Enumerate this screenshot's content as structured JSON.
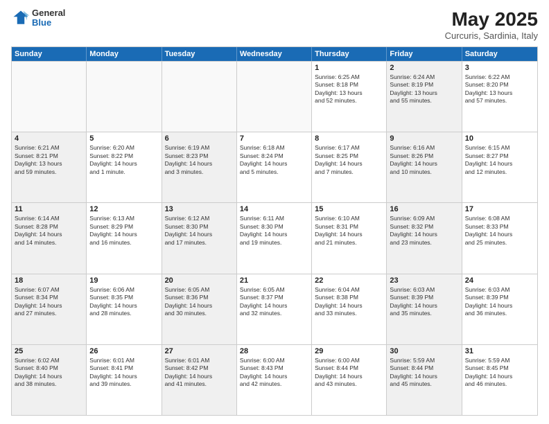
{
  "header": {
    "logo": {
      "general": "General",
      "blue": "Blue"
    },
    "title": "May 2025",
    "location": "Curcuris, Sardinia, Italy"
  },
  "days_of_week": [
    "Sunday",
    "Monday",
    "Tuesday",
    "Wednesday",
    "Thursday",
    "Friday",
    "Saturday"
  ],
  "rows": [
    [
      {
        "day": "",
        "detail": "",
        "empty": true
      },
      {
        "day": "",
        "detail": "",
        "empty": true
      },
      {
        "day": "",
        "detail": "",
        "empty": true
      },
      {
        "day": "",
        "detail": "",
        "empty": true
      },
      {
        "day": "1",
        "detail": "Sunrise: 6:25 AM\nSunset: 8:18 PM\nDaylight: 13 hours\nand 52 minutes.",
        "shaded": false
      },
      {
        "day": "2",
        "detail": "Sunrise: 6:24 AM\nSunset: 8:19 PM\nDaylight: 13 hours\nand 55 minutes.",
        "shaded": true
      },
      {
        "day": "3",
        "detail": "Sunrise: 6:22 AM\nSunset: 8:20 PM\nDaylight: 13 hours\nand 57 minutes.",
        "shaded": false
      }
    ],
    [
      {
        "day": "4",
        "detail": "Sunrise: 6:21 AM\nSunset: 8:21 PM\nDaylight: 13 hours\nand 59 minutes.",
        "shaded": true
      },
      {
        "day": "5",
        "detail": "Sunrise: 6:20 AM\nSunset: 8:22 PM\nDaylight: 14 hours\nand 1 minute.",
        "shaded": false
      },
      {
        "day": "6",
        "detail": "Sunrise: 6:19 AM\nSunset: 8:23 PM\nDaylight: 14 hours\nand 3 minutes.",
        "shaded": true
      },
      {
        "day": "7",
        "detail": "Sunrise: 6:18 AM\nSunset: 8:24 PM\nDaylight: 14 hours\nand 5 minutes.",
        "shaded": false
      },
      {
        "day": "8",
        "detail": "Sunrise: 6:17 AM\nSunset: 8:25 PM\nDaylight: 14 hours\nand 7 minutes.",
        "shaded": false
      },
      {
        "day": "9",
        "detail": "Sunrise: 6:16 AM\nSunset: 8:26 PM\nDaylight: 14 hours\nand 10 minutes.",
        "shaded": true
      },
      {
        "day": "10",
        "detail": "Sunrise: 6:15 AM\nSunset: 8:27 PM\nDaylight: 14 hours\nand 12 minutes.",
        "shaded": false
      }
    ],
    [
      {
        "day": "11",
        "detail": "Sunrise: 6:14 AM\nSunset: 8:28 PM\nDaylight: 14 hours\nand 14 minutes.",
        "shaded": true
      },
      {
        "day": "12",
        "detail": "Sunrise: 6:13 AM\nSunset: 8:29 PM\nDaylight: 14 hours\nand 16 minutes.",
        "shaded": false
      },
      {
        "day": "13",
        "detail": "Sunrise: 6:12 AM\nSunset: 8:30 PM\nDaylight: 14 hours\nand 17 minutes.",
        "shaded": true
      },
      {
        "day": "14",
        "detail": "Sunrise: 6:11 AM\nSunset: 8:30 PM\nDaylight: 14 hours\nand 19 minutes.",
        "shaded": false
      },
      {
        "day": "15",
        "detail": "Sunrise: 6:10 AM\nSunset: 8:31 PM\nDaylight: 14 hours\nand 21 minutes.",
        "shaded": false
      },
      {
        "day": "16",
        "detail": "Sunrise: 6:09 AM\nSunset: 8:32 PM\nDaylight: 14 hours\nand 23 minutes.",
        "shaded": true
      },
      {
        "day": "17",
        "detail": "Sunrise: 6:08 AM\nSunset: 8:33 PM\nDaylight: 14 hours\nand 25 minutes.",
        "shaded": false
      }
    ],
    [
      {
        "day": "18",
        "detail": "Sunrise: 6:07 AM\nSunset: 8:34 PM\nDaylight: 14 hours\nand 27 minutes.",
        "shaded": true
      },
      {
        "day": "19",
        "detail": "Sunrise: 6:06 AM\nSunset: 8:35 PM\nDaylight: 14 hours\nand 28 minutes.",
        "shaded": false
      },
      {
        "day": "20",
        "detail": "Sunrise: 6:05 AM\nSunset: 8:36 PM\nDaylight: 14 hours\nand 30 minutes.",
        "shaded": true
      },
      {
        "day": "21",
        "detail": "Sunrise: 6:05 AM\nSunset: 8:37 PM\nDaylight: 14 hours\nand 32 minutes.",
        "shaded": false
      },
      {
        "day": "22",
        "detail": "Sunrise: 6:04 AM\nSunset: 8:38 PM\nDaylight: 14 hours\nand 33 minutes.",
        "shaded": false
      },
      {
        "day": "23",
        "detail": "Sunrise: 6:03 AM\nSunset: 8:39 PM\nDaylight: 14 hours\nand 35 minutes.",
        "shaded": true
      },
      {
        "day": "24",
        "detail": "Sunrise: 6:03 AM\nSunset: 8:39 PM\nDaylight: 14 hours\nand 36 minutes.",
        "shaded": false
      }
    ],
    [
      {
        "day": "25",
        "detail": "Sunrise: 6:02 AM\nSunset: 8:40 PM\nDaylight: 14 hours\nand 38 minutes.",
        "shaded": true
      },
      {
        "day": "26",
        "detail": "Sunrise: 6:01 AM\nSunset: 8:41 PM\nDaylight: 14 hours\nand 39 minutes.",
        "shaded": false
      },
      {
        "day": "27",
        "detail": "Sunrise: 6:01 AM\nSunset: 8:42 PM\nDaylight: 14 hours\nand 41 minutes.",
        "shaded": true
      },
      {
        "day": "28",
        "detail": "Sunrise: 6:00 AM\nSunset: 8:43 PM\nDaylight: 14 hours\nand 42 minutes.",
        "shaded": false
      },
      {
        "day": "29",
        "detail": "Sunrise: 6:00 AM\nSunset: 8:44 PM\nDaylight: 14 hours\nand 43 minutes.",
        "shaded": false
      },
      {
        "day": "30",
        "detail": "Sunrise: 5:59 AM\nSunset: 8:44 PM\nDaylight: 14 hours\nand 45 minutes.",
        "shaded": true
      },
      {
        "day": "31",
        "detail": "Sunrise: 5:59 AM\nSunset: 8:45 PM\nDaylight: 14 hours\nand 46 minutes.",
        "shaded": false
      }
    ]
  ]
}
